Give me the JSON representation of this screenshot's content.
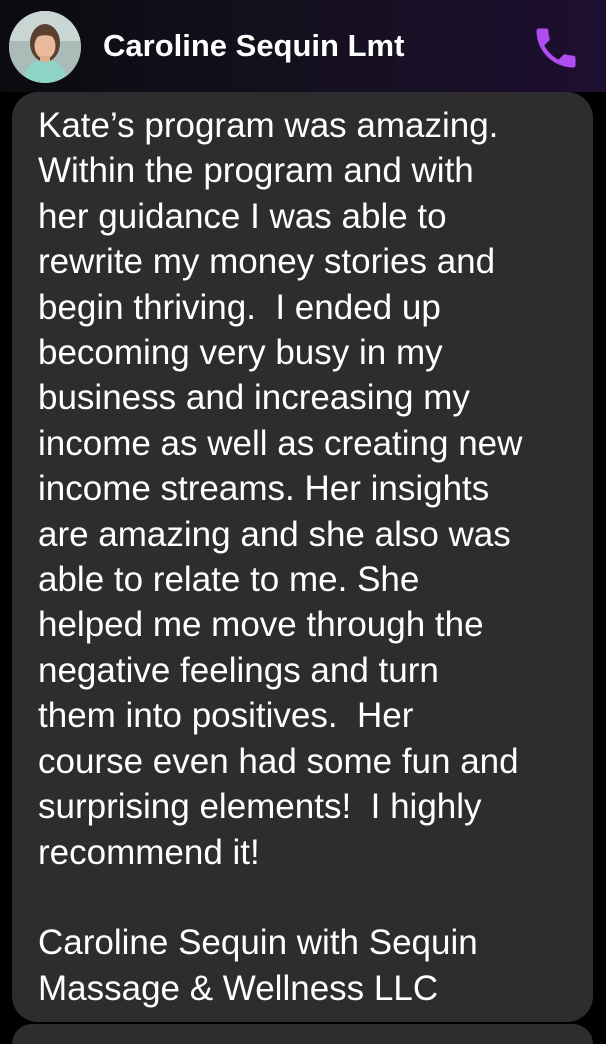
{
  "header": {
    "contact_name": "Caroline Sequin Lmt",
    "avatar_icon": "contact-photo",
    "call_icon": "phone-icon",
    "accent_color": "#b14cf0"
  },
  "message": {
    "lines": [
      "Kate’s program was amazing.",
      "Within the program and with",
      "her guidance I was able to",
      "rewrite my money stories and",
      "begin thriving.  I ended up",
      "becoming very busy in my",
      "business and increasing my",
      "income as well as creating new",
      "income streams. Her insights",
      "are amazing and she also was",
      "able to relate to me. She",
      "helped me move through the",
      "negative feelings and turn",
      "them into positives.  Her",
      "course even had some fun and",
      "surprising elements!  I highly",
      "recommend it!",
      "",
      "Caroline Sequin with Sequin",
      "Massage & Wellness LLC"
    ],
    "bubble_color": "#2d2d2f"
  }
}
